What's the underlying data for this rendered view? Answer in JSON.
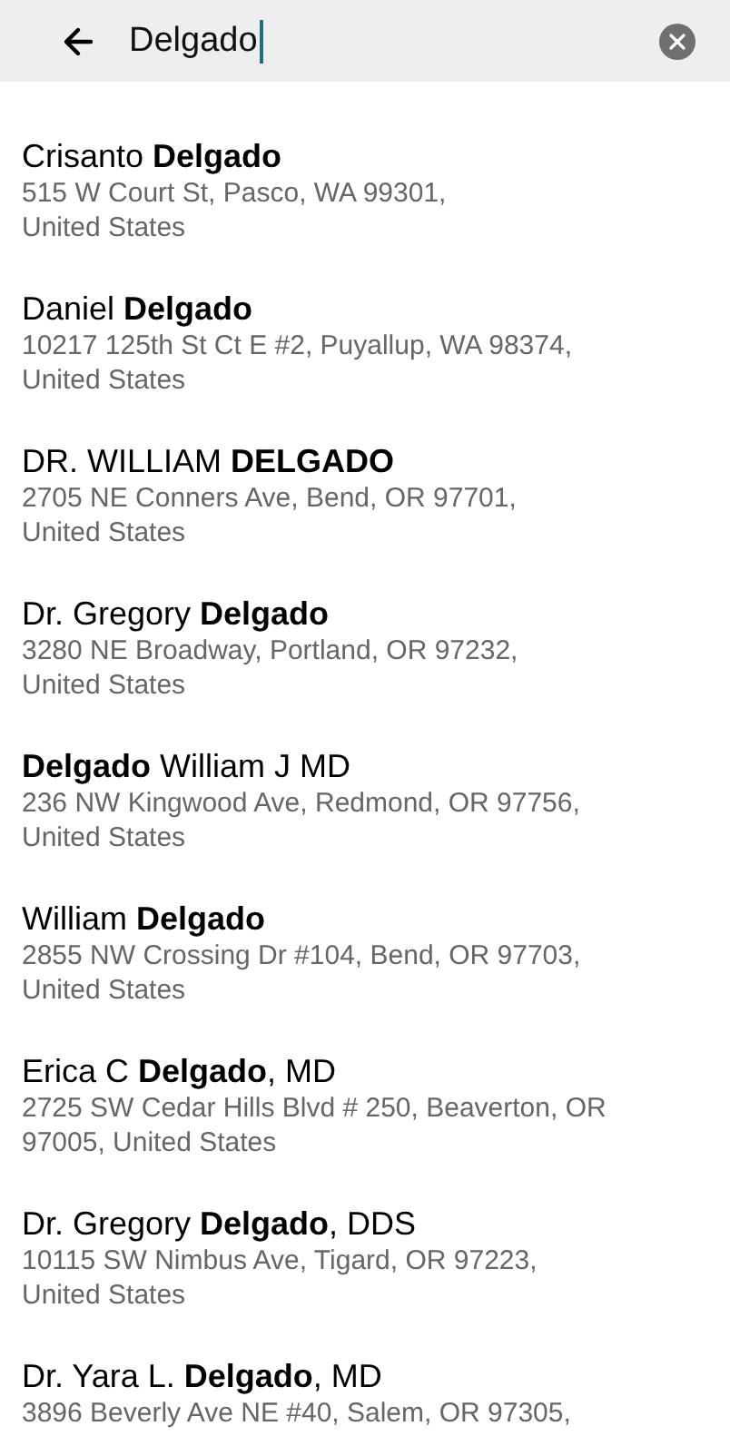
{
  "search": {
    "value": "Delgado"
  },
  "results": [
    {
      "name": "Crisanto **Delgado**",
      "address_lines": [
        "515 W Court St, Pasco, WA 99301,",
        "United States"
      ]
    },
    {
      "name": "Daniel **Delgado**",
      "address_lines": [
        "10217 125th St Ct E #2, Puyallup, WA 98374,",
        "United States"
      ]
    },
    {
      "name": "DR. WILLIAM **DELGADO**",
      "address_lines": [
        "2705 NE Conners Ave, Bend, OR 97701,",
        "United States"
      ]
    },
    {
      "name": "Dr. Gregory **Delgado**",
      "address_lines": [
        "3280 NE Broadway, Portland, OR 97232,",
        "United States"
      ]
    },
    {
      "name": "**Delgado** William J MD",
      "address_lines": [
        "236 NW Kingwood Ave, Redmond, OR 97756,",
        "United States"
      ]
    },
    {
      "name": "William **Delgado**",
      "address_lines": [
        "2855 NW Crossing Dr #104, Bend, OR 97703,",
        "United States"
      ]
    },
    {
      "name": "Erica C **Delgado**, MD",
      "address_lines": [
        "2725 SW Cedar Hills Blvd # 250, Beaverton, OR",
        "97005, United States"
      ]
    },
    {
      "name": "Dr. Gregory **Delgado**, DDS",
      "address_lines": [
        "10115 SW Nimbus Ave, Tigard, OR 97223,",
        "United States"
      ]
    },
    {
      "name": "Dr. Yara L. **Delgado**, MD",
      "address_lines": [
        "3896 Beverly Ave NE #40, Salem, OR 97305,"
      ]
    }
  ]
}
